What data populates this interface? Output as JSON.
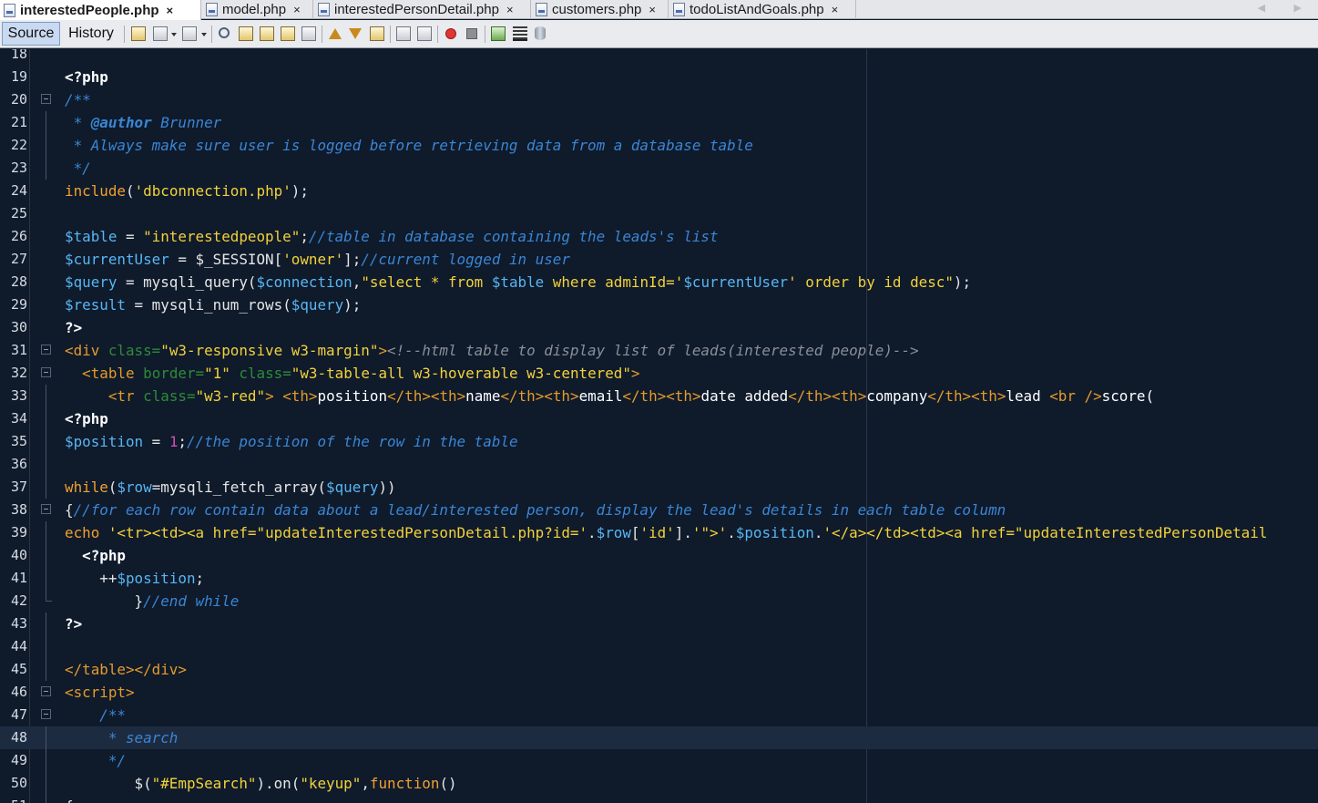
{
  "tabs": [
    {
      "label": "interestedPeople.php",
      "active": true,
      "close": "×"
    },
    {
      "label": "model.php",
      "active": false,
      "close": "×"
    },
    {
      "label": "interestedPersonDetail.php",
      "active": false,
      "close": "×"
    },
    {
      "label": "customers.php",
      "active": false,
      "close": "×"
    },
    {
      "label": "todoListAndGoals.php",
      "active": false,
      "close": "×"
    }
  ],
  "tab_nav": "◀ ▶",
  "toolbar": {
    "source_label": "Source",
    "history_label": "History"
  },
  "editor": {
    "current_line": 48,
    "lines": [
      {
        "n": "18",
        "tokens": []
      },
      {
        "n": "19",
        "tokens": [
          [
            "phpt",
            "<?php"
          ]
        ]
      },
      {
        "n": "20",
        "fold": "open",
        "tokens": [
          [
            "cm",
            "/**"
          ]
        ]
      },
      {
        "n": "21",
        "tokens": [
          [
            "cm",
            " * "
          ],
          [
            "cmtag",
            "@author"
          ],
          [
            "cm",
            " Brunner"
          ]
        ]
      },
      {
        "n": "22",
        "tokens": [
          [
            "cm",
            " * Always make sure user is logged before retrieving data from a database table"
          ]
        ]
      },
      {
        "n": "23",
        "tokens": [
          [
            "cm",
            " */"
          ]
        ]
      },
      {
        "n": "24",
        "tokens": [
          [
            "kw",
            "include"
          ],
          [
            "pl",
            "("
          ],
          [
            "str",
            "'dbconnection.php'"
          ],
          [
            "pl",
            ");"
          ]
        ]
      },
      {
        "n": "25",
        "tokens": []
      },
      {
        "n": "26",
        "tokens": [
          [
            "var",
            "$table"
          ],
          [
            "pl",
            " = "
          ],
          [
            "str",
            "\"interestedpeople\""
          ],
          [
            "pl",
            ";"
          ],
          [
            "cm",
            "//table in database containing the leads's list"
          ]
        ]
      },
      {
        "n": "27",
        "tokens": [
          [
            "var",
            "$currentUser"
          ],
          [
            "pl",
            " = $_SESSION["
          ],
          [
            "str",
            "'owner'"
          ],
          [
            "pl",
            "];"
          ],
          [
            "cm",
            "//current logged in user"
          ]
        ]
      },
      {
        "n": "28",
        "tokens": [
          [
            "var",
            "$query"
          ],
          [
            "pl",
            " = mysqli_query("
          ],
          [
            "var",
            "$connection"
          ],
          [
            "pl",
            ","
          ],
          [
            "str",
            "\"select * from "
          ],
          [
            "var",
            "$table"
          ],
          [
            "str",
            " where adminId='"
          ],
          [
            "var",
            "$currentUser"
          ],
          [
            "str",
            "' order by id desc\""
          ],
          [
            "pl",
            ");"
          ]
        ]
      },
      {
        "n": "29",
        "tokens": [
          [
            "var",
            "$result"
          ],
          [
            "pl",
            " = mysqli_num_rows("
          ],
          [
            "var",
            "$query"
          ],
          [
            "pl",
            ");"
          ]
        ]
      },
      {
        "n": "30",
        "tokens": [
          [
            "phpt",
            "?>"
          ]
        ]
      },
      {
        "n": "31",
        "fold": "open",
        "tokens": [
          [
            "tag",
            "<div "
          ],
          [
            "attr",
            "class="
          ],
          [
            "hstr",
            "\"w3-responsive w3-margin\""
          ],
          [
            "tag",
            ">"
          ],
          [
            "hcm",
            "<!--html table to display list of leads(interested people)-->"
          ]
        ]
      },
      {
        "n": "32",
        "fold": "open",
        "tokens": [
          [
            "pl",
            "  "
          ],
          [
            "tag",
            "<table "
          ],
          [
            "attr",
            "border="
          ],
          [
            "hstr",
            "\"1\""
          ],
          [
            "attr",
            " class="
          ],
          [
            "hstr",
            "\"w3-table-all w3-hoverable w3-centered\""
          ],
          [
            "tag",
            ">"
          ]
        ]
      },
      {
        "n": "33",
        "tokens": [
          [
            "pl",
            "     "
          ],
          [
            "tag",
            "<tr "
          ],
          [
            "attr",
            "class="
          ],
          [
            "hstr",
            "\"w3-red\""
          ],
          [
            "tag",
            ">"
          ],
          [
            "pl",
            " "
          ],
          [
            "tag",
            "<th>"
          ],
          [
            "htxt",
            "position"
          ],
          [
            "tag",
            "</th><th>"
          ],
          [
            "htxt",
            "name"
          ],
          [
            "tag",
            "</th><th>"
          ],
          [
            "htxt",
            "email"
          ],
          [
            "tag",
            "</th><th>"
          ],
          [
            "htxt",
            "date added"
          ],
          [
            "tag",
            "</th><th>"
          ],
          [
            "htxt",
            "company"
          ],
          [
            "tag",
            "</th><th>"
          ],
          [
            "htxt",
            "lead "
          ],
          [
            "tag",
            "<br />"
          ],
          [
            "htxt",
            "score("
          ]
        ]
      },
      {
        "n": "34",
        "tokens": [
          [
            "phpt",
            "<?php"
          ]
        ]
      },
      {
        "n": "35",
        "tokens": [
          [
            "var",
            "$position"
          ],
          [
            "pl",
            " = "
          ],
          [
            "num",
            "1"
          ],
          [
            "pl",
            ";"
          ],
          [
            "cm",
            "//the position of the row in the table"
          ]
        ]
      },
      {
        "n": "36",
        "tokens": []
      },
      {
        "n": "37",
        "tokens": [
          [
            "kw",
            "while"
          ],
          [
            "pl",
            "("
          ],
          [
            "var",
            "$row"
          ],
          [
            "pl",
            "=mysqli_fetch_array("
          ],
          [
            "var",
            "$query"
          ],
          [
            "pl",
            "))"
          ]
        ]
      },
      {
        "n": "38",
        "fold": "open",
        "tokens": [
          [
            "pl",
            "{"
          ],
          [
            "cm",
            "//for each row contain data about a lead/interested person, display the lead's details in each table column"
          ]
        ]
      },
      {
        "n": "39",
        "tokens": [
          [
            "kw",
            "echo"
          ],
          [
            "pl",
            " "
          ],
          [
            "str",
            "'<tr><td><a href=\"updateInterestedPersonDetail.php?id='"
          ],
          [
            "pl",
            "."
          ],
          [
            "var",
            "$row"
          ],
          [
            "pl",
            "["
          ],
          [
            "str",
            "'id'"
          ],
          [
            "pl",
            "]."
          ],
          [
            "str",
            "'\">'"
          ],
          [
            "pl",
            "."
          ],
          [
            "var",
            "$position"
          ],
          [
            "pl",
            "."
          ],
          [
            "str",
            "'</a></td><td><a href=\"updateInterestedPersonDetail"
          ]
        ]
      },
      {
        "n": "40",
        "tokens": [
          [
            "pl",
            "  "
          ],
          [
            "phpt",
            "<?php"
          ]
        ]
      },
      {
        "n": "41",
        "tokens": [
          [
            "pl",
            "    ++"
          ],
          [
            "var",
            "$position"
          ],
          [
            "pl",
            ";"
          ]
        ]
      },
      {
        "n": "42",
        "fold": "end",
        "tokens": [
          [
            "pl",
            "        }"
          ],
          [
            "cm",
            "//end while"
          ]
        ]
      },
      {
        "n": "43",
        "tokens": [
          [
            "phpt",
            "?>"
          ]
        ]
      },
      {
        "n": "44",
        "tokens": []
      },
      {
        "n": "45",
        "tokens": [
          [
            "tag",
            "</table></div>"
          ]
        ]
      },
      {
        "n": "46",
        "fold": "open",
        "tokens": [
          [
            "tag",
            "<script>"
          ]
        ]
      },
      {
        "n": "47",
        "fold": "open",
        "tokens": [
          [
            "cm",
            "    /**"
          ]
        ]
      },
      {
        "n": "48",
        "tokens": [
          [
            "cm",
            "     * search"
          ]
        ]
      },
      {
        "n": "49",
        "tokens": [
          [
            "cm",
            "     */"
          ]
        ]
      },
      {
        "n": "50",
        "tokens": [
          [
            "pl",
            "        $("
          ],
          [
            "str",
            "\"#EmpSearch\""
          ],
          [
            "pl",
            ").on("
          ],
          [
            "str",
            "\"keyup\""
          ],
          [
            "pl",
            ","
          ],
          [
            "kw",
            "function"
          ],
          [
            "pl",
            "()"
          ]
        ]
      },
      {
        "n": "51",
        "tokens": [
          [
            "pl",
            "{"
          ]
        ]
      }
    ]
  }
}
